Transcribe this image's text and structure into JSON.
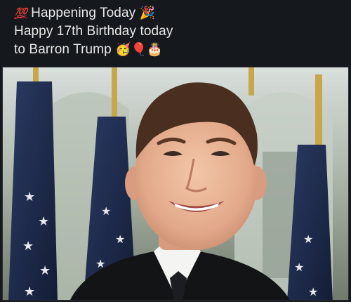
{
  "post": {
    "line1_emoji_start": "💯",
    "line1_text": "Happening Today",
    "line1_emoji_end": "🎉",
    "line2_text": "Happy 17th Birthday today",
    "line3_text": "to Barron Trump",
    "line3_emojis": [
      "🥳",
      "🎈",
      "🎂"
    ]
  },
  "media": {
    "type": "photo",
    "colors": {
      "background": "#15181c",
      "text": "#e7e9ea",
      "flag_navy": "#1d2b4f",
      "gold": "#c8a64a"
    }
  }
}
